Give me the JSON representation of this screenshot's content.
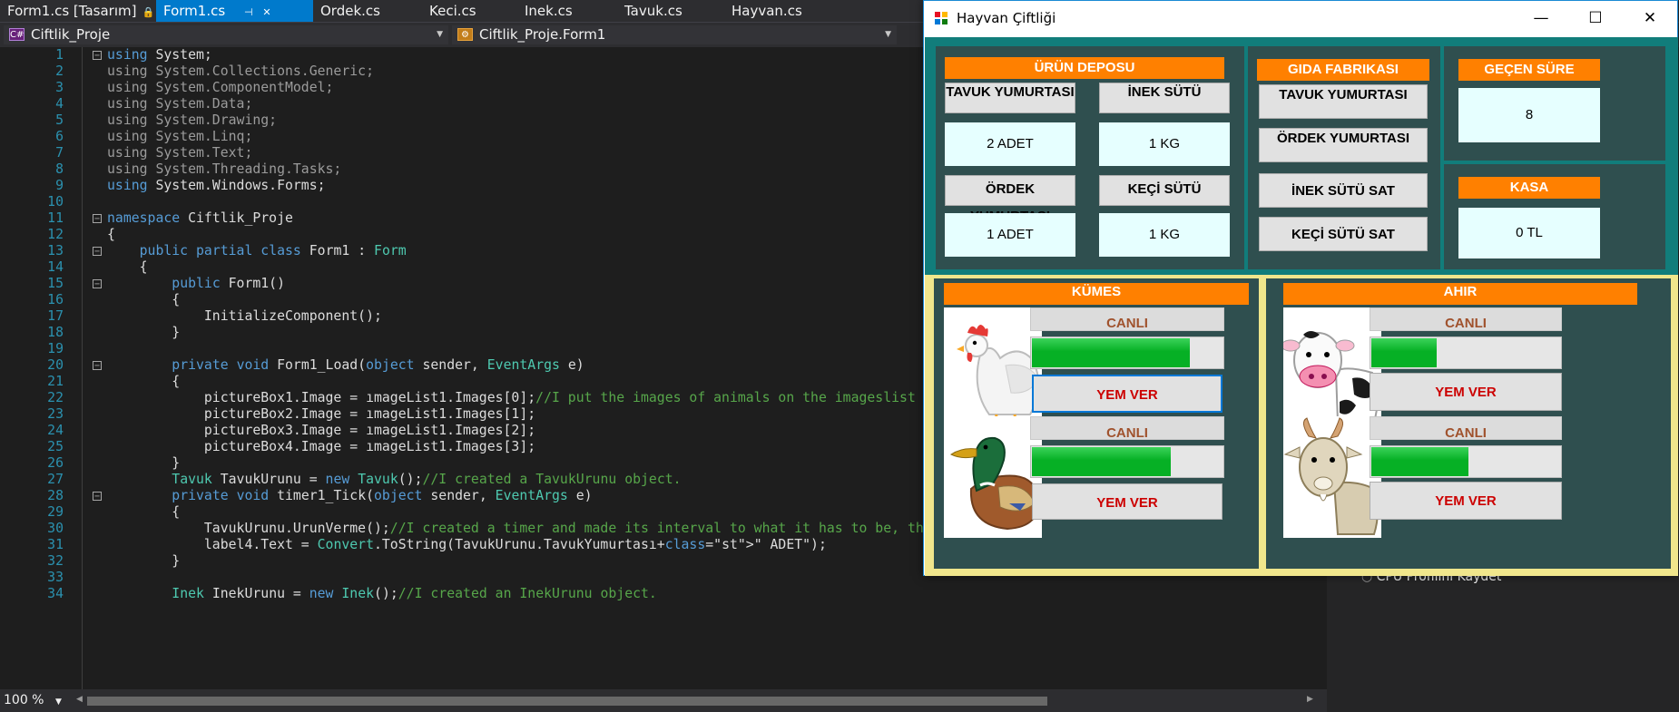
{
  "ide": {
    "tabs": [
      {
        "label": "Form1.cs [Tasarım]",
        "icon": "pin-icon",
        "active": false
      },
      {
        "label": "Form1.cs",
        "icon": "pin-icon",
        "active": true
      },
      {
        "label": "Ordek.cs"
      },
      {
        "label": "Keci.cs"
      },
      {
        "label": "Inek.cs"
      },
      {
        "label": "Tavuk.cs"
      },
      {
        "label": "Hayvan.cs"
      }
    ],
    "tab_close_glyph": "✕",
    "nav": {
      "project_combo": "Ciftlik_Proje",
      "class_combo": "Ciftlik_Proje.Form1"
    },
    "zoom": "100 %",
    "peek_text": "CPU Profilini Kaydet"
  },
  "code_lines": [
    {
      "n": "1",
      "t": "using System;"
    },
    {
      "n": "2",
      "t": "using System.Collections.Generic;"
    },
    {
      "n": "3",
      "t": "using System.ComponentModel;"
    },
    {
      "n": "4",
      "t": "using System.Data;"
    },
    {
      "n": "5",
      "t": "using System.Drawing;"
    },
    {
      "n": "6",
      "t": "using System.Linq;"
    },
    {
      "n": "7",
      "t": "using System.Text;"
    },
    {
      "n": "8",
      "t": "using System.Threading.Tasks;"
    },
    {
      "n": "9",
      "t": "using System.Windows.Forms;"
    },
    {
      "n": "10",
      "t": ""
    },
    {
      "n": "11",
      "t": "namespace Ciftlik_Proje"
    },
    {
      "n": "12",
      "t": "{"
    },
    {
      "n": "13",
      "t": "    public partial class Form1 : Form"
    },
    {
      "n": "14",
      "t": "    {"
    },
    {
      "n": "15",
      "t": "        public Form1()"
    },
    {
      "n": "16",
      "t": "        {"
    },
    {
      "n": "17",
      "t": "            InitializeComponent();"
    },
    {
      "n": "18",
      "t": "        }"
    },
    {
      "n": "19",
      "t": ""
    },
    {
      "n": "20",
      "t": "        private void Form1_Load(object sender, EventArgs e)"
    },
    {
      "n": "21",
      "t": "        {"
    },
    {
      "n": "22",
      "t": "            pictureBox1.Image = ımageList1.Images[0];//I put the images of animals on the imageslist"
    },
    {
      "n": "23",
      "t": "            pictureBox2.Image = ımageList1.Images[1];"
    },
    {
      "n": "24",
      "t": "            pictureBox3.Image = ımageList1.Images[2];"
    },
    {
      "n": "25",
      "t": "            pictureBox4.Image = ımageList1.Images[3];"
    },
    {
      "n": "26",
      "t": "        }"
    },
    {
      "n": "27",
      "t": "        Tavuk TavukUrunu = new Tavuk();//I created a TavukUrunu object."
    },
    {
      "n": "28",
      "t": "        private void timer1_Tick(object sender, EventArgs e)"
    },
    {
      "n": "29",
      "t": "        {"
    },
    {
      "n": "30",
      "t": "            TavukUrunu.UrunVerme();//I created a timer and made its interval to what it has to be, then called UrunVerme function of Tavuk class in t"
    },
    {
      "n": "31",
      "t": "            label4.Text = Convert.ToString(TavukUrunu.TavukYumurtası+\" ADET\");"
    },
    {
      "n": "32",
      "t": "        }"
    },
    {
      "n": "33",
      "t": ""
    },
    {
      "n": "34",
      "t": "        Inek InekUrunu = new Inek();//I created an InekUrunu object."
    }
  ],
  "form": {
    "title": "Hayvan Çiftliği",
    "buttons": {
      "minimize": "—",
      "maximize": "☐",
      "close": "✕"
    },
    "urun_deposu": {
      "header": "ÜRÜN DEPOSU",
      "tavuk_label": "TAVUK YUMURTASI",
      "tavuk_value": "2 ADET",
      "inek_label": "İNEK SÜTÜ",
      "inek_value": "1 KG",
      "ordek_label": "ÖRDEK YUMURTASI",
      "ordek_value": "1 ADET",
      "keci_label": "KEÇİ SÜTÜ",
      "keci_value": "1 KG"
    },
    "gida_fabrikasi": {
      "header": "GIDA FABRIKASI",
      "btn1": "TAVUK YUMURTASI",
      "btn2": "ÖRDEK YUMURTASI",
      "btn3": "İNEK SÜTÜ SAT",
      "btn4": "KEÇİ SÜTÜ SAT"
    },
    "gecen_sure": {
      "header": "GEÇEN SÜRE",
      "value": "8"
    },
    "kasa": {
      "header": "KASA",
      "value": "0 TL"
    },
    "kumes": {
      "header": "KÜMES",
      "animals": [
        {
          "name": "tavuk",
          "status": "CANLI",
          "health": 0.83,
          "feed": "YEM VER"
        },
        {
          "name": "ordek",
          "status": "CANLI",
          "health": 0.73,
          "feed": "YEM VER"
        }
      ]
    },
    "ahir": {
      "header": "AHIR",
      "animals": [
        {
          "name": "inek",
          "status": "CANLI",
          "health": 0.35,
          "feed": "YEM VER"
        },
        {
          "name": "keci",
          "status": "CANLI",
          "health": 0.52,
          "feed": "YEM VER"
        }
      ]
    },
    "colors": {
      "upper_bg": "#117d7b",
      "upper_inner": "#2f4f4f",
      "lower_bg": "#f0e68c",
      "header_orange": "#ff8000",
      "value_bg": "#e6ffff",
      "progress_green": "#06b025",
      "feed_text": "#cc0000",
      "status_text": "#a0522d"
    }
  }
}
